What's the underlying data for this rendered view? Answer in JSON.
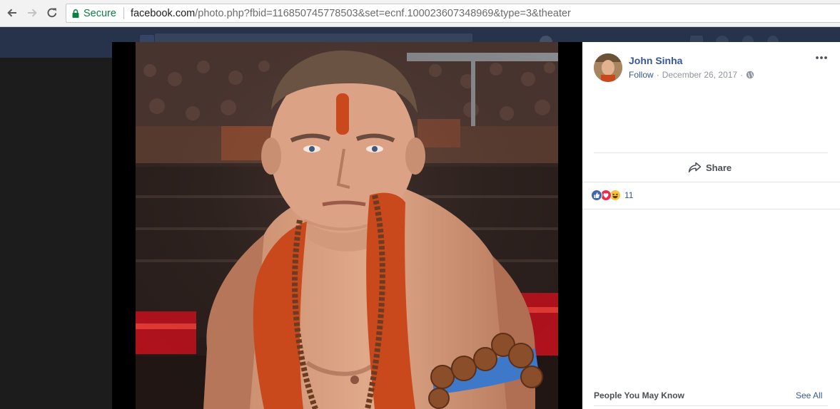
{
  "browser": {
    "secure_label": "Secure",
    "url_domain": "facebook.com",
    "url_path": "/photo.php?fbid=116850745778503&set=ecnf.100023607348969&type=3&theater",
    "icons": [
      "back-arrow-icon",
      "forward-arrow-icon",
      "reload-icon",
      "lock-icon"
    ]
  },
  "post": {
    "author": "John Sinha",
    "follow": "Follow",
    "separator": "·",
    "date": "December 26, 2017",
    "privacy_icon": "globe-icon",
    "more_icon": "more-options-icon",
    "share_label": "Share",
    "reactions": [
      "like",
      "love",
      "haha"
    ],
    "reaction_count": "11"
  },
  "sidebar": {
    "people_you_may_know": "People You May Know",
    "see_all": "See All"
  },
  "colors": {
    "fb_blue": "#365899",
    "secure_green": "#0b8043",
    "like_blue": "#4267b2",
    "love_red": "#f0284a",
    "haha_yellow": "#f7c338",
    "saffron": "#c9481c"
  }
}
